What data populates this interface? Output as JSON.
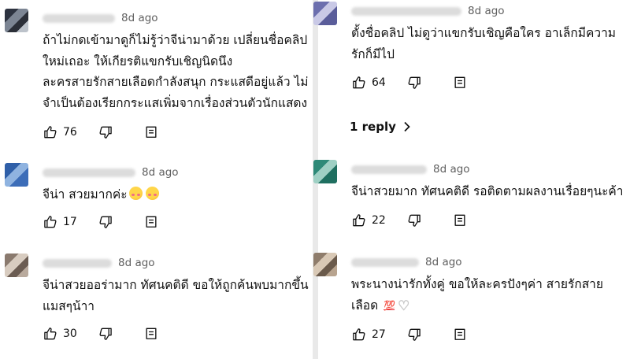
{
  "icons": {
    "like": "thumbs-up-icon",
    "dislike": "thumbs-down-icon",
    "reply": "comment-reply-icon",
    "replies": "chevron-right-icon"
  },
  "colors": {
    "text": "#0f0f0f",
    "muted": "#606060",
    "divider": "#e9e9e9"
  },
  "left_comments": [
    {
      "time": "8d ago",
      "lines": [
        "ถ้าไม่กดเข้ามาดูก็ไม่รู้ว่าจีน่ามาด้วย เปลี่ยนชื่อคลิป",
        "ใหม่เถอะ ให้เกียรติแขกรับเชิญนิดนึง",
        "ละครสายรักสายเลือดกำลังสนุก กระแสดีอยู่แล้ว ไม่",
        "จำเป็นต้องเรียกกระแสเพิ่มจากเรื่องส่วนตัวนักแสดง"
      ],
      "likes": "76"
    },
    {
      "time": "8d ago",
      "lines": [
        "จีน่า สวยมากค่ะ"
      ],
      "emojis": [
        "smiling-face-with-hearts",
        "smiling-face-with-hearts"
      ],
      "likes": "17"
    },
    {
      "time": "8d ago",
      "lines": [
        "จีน่าสวยออร่ามาก ทัศนคติดี ขอให้ถูกค้นพบมากขึ้น",
        "แมสๆน้าา"
      ],
      "likes": "30"
    }
  ],
  "right_comments": [
    {
      "time": "8d ago",
      "lines": [
        "ตั้งชื่อคลิป ไม่ดูว่าแขกรับเชิญคือใคร อาเล็กมีความ",
        "รักก็มีไป"
      ],
      "likes": "64",
      "replies_label": "1 reply"
    },
    {
      "time": "8d ago",
      "lines": [
        "จีน่าสวยมาก ทัศนคติดี รอติดตามผลงานเรื่อยๆนะค้า"
      ],
      "likes": "22"
    },
    {
      "time": "8d ago",
      "lines": [
        "พระนางน่ารักทั้งคู่ ขอให้ละครปังๆค่า สายรักสาย",
        "เลือด"
      ],
      "emoji_100": "💯",
      "emoji_heart": "♡",
      "likes": "27"
    }
  ]
}
